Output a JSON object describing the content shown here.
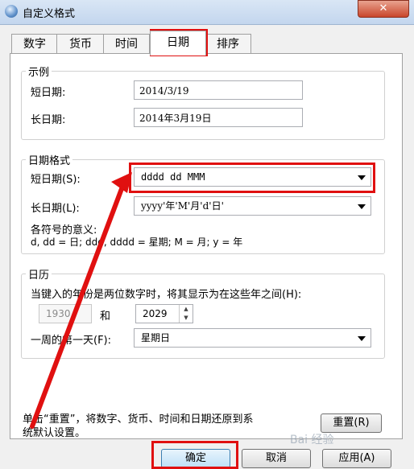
{
  "window": {
    "title": "自定义格式",
    "close_glyph": "✕"
  },
  "tabs": [
    {
      "label": "数字"
    },
    {
      "label": "货币"
    },
    {
      "label": "时间"
    },
    {
      "label": "日期"
    },
    {
      "label": "排序"
    }
  ],
  "example": {
    "group_label": "示例",
    "short_label": "短日期:",
    "short_value": "2014/3/19",
    "long_label": "长日期:",
    "long_value": "2014年3月19日"
  },
  "date_format": {
    "group_label": "日期格式",
    "short_label": "短日期(S):",
    "short_value": "dddd dd MMM",
    "long_label": "长日期(L):",
    "long_value": "yyyy'年'M'月'd'日'",
    "legend_title": "各符号的意义:",
    "legend_text": "d, dd = 日;  ddd, dddd = 星期;  M = 月;  y = 年"
  },
  "calendar": {
    "group_label": "日历",
    "two_digit_text": "当键入的年份是两位数字时，将其显示为在这些年之间(H):",
    "year_from": "1930",
    "and_label": "和",
    "year_to": "2029",
    "first_day_label": "一周的第一天(F):",
    "first_day_value": "星期日"
  },
  "reset_note": {
    "line1": "单击“重置”，将数字、货币、时间和日期还原到系",
    "line2": "统默认设置。",
    "reset_button": "重置(R)"
  },
  "footer": {
    "ok_button": "确定",
    "cancel_button": "取消",
    "apply_button": "应用(A)"
  },
  "annotation": {
    "highlight_color": "#e01010",
    "watermark": "Bai 经验"
  }
}
